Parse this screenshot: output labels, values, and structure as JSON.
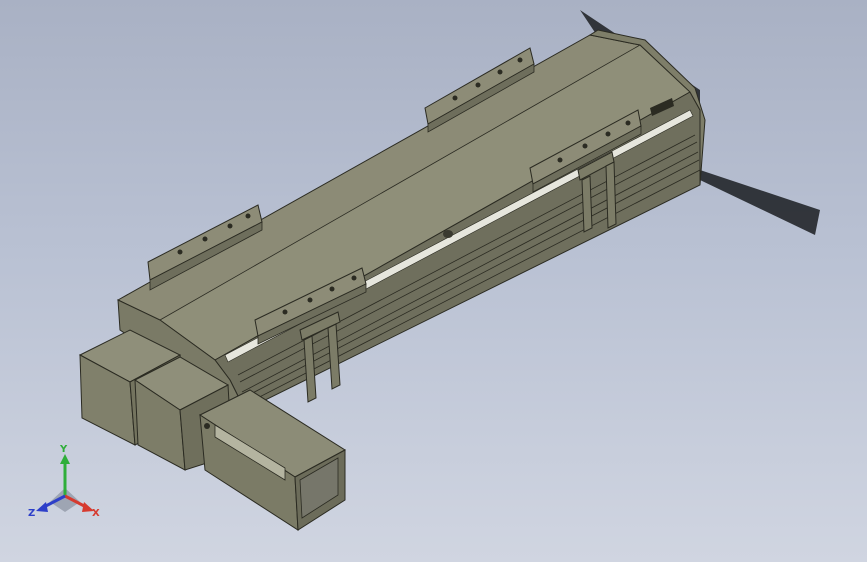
{
  "viewport": {
    "background_top": "#a9b1c4",
    "background_bottom": "#d0d5e1"
  },
  "model": {
    "body_color": "#84846e",
    "edge_color": "#2b2b22",
    "shadow_color": "#2a2d33"
  },
  "triad": {
    "x_label": "X",
    "y_label": "Y",
    "z_label": "Z",
    "x_color": "#d63a2f",
    "y_color": "#2fae3a",
    "z_color": "#2d3fc9"
  }
}
